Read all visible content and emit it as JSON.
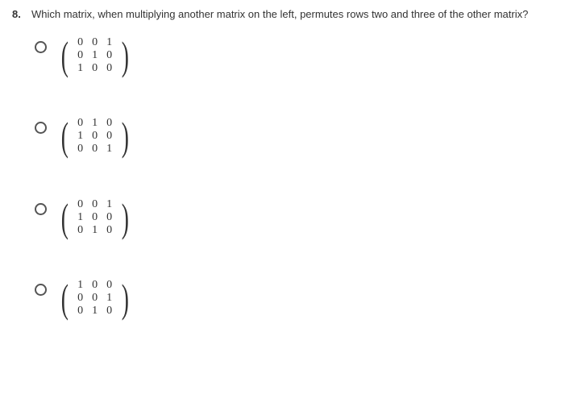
{
  "question": {
    "number": "8.",
    "text": "Which matrix, when multiplying another matrix on the left, permutes rows two and three of the other matrix?"
  },
  "options": [
    {
      "rows": [
        [
          "0",
          "0",
          "1"
        ],
        [
          "0",
          "1",
          "0"
        ],
        [
          "1",
          "0",
          "0"
        ]
      ]
    },
    {
      "rows": [
        [
          "0",
          "1",
          "0"
        ],
        [
          "1",
          "0",
          "0"
        ],
        [
          "0",
          "0",
          "1"
        ]
      ]
    },
    {
      "rows": [
        [
          "0",
          "0",
          "1"
        ],
        [
          "1",
          "0",
          "0"
        ],
        [
          "0",
          "1",
          "0"
        ]
      ]
    },
    {
      "rows": [
        [
          "1",
          "0",
          "0"
        ],
        [
          "0",
          "0",
          "1"
        ],
        [
          "0",
          "1",
          "0"
        ]
      ]
    }
  ]
}
